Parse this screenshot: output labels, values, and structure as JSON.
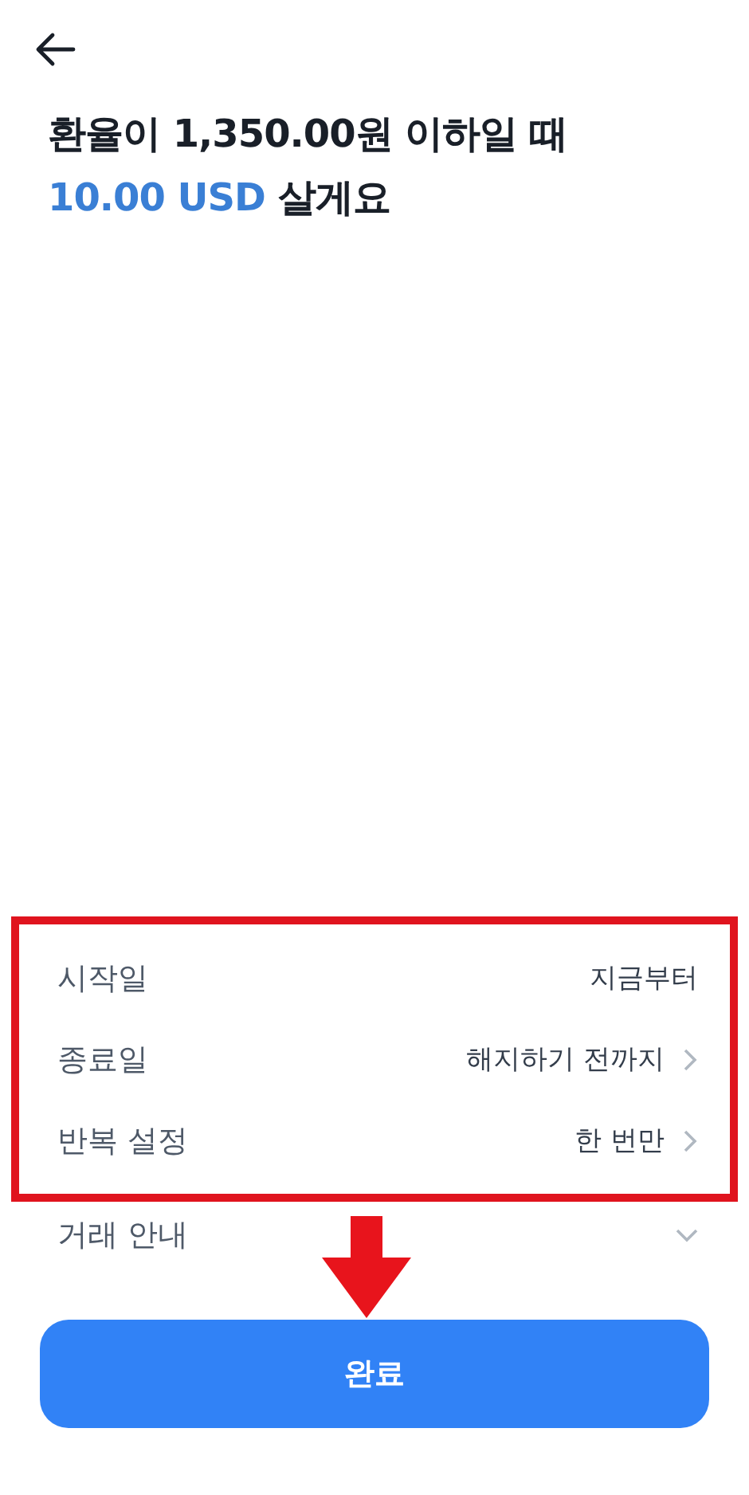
{
  "title": {
    "line_1": "환율이 1,350.00원 이하일 때",
    "amount": "10.00 USD",
    "line_2_rest": "살게요"
  },
  "settings": {
    "highlighted": true,
    "rows": [
      {
        "label": "시작일",
        "value": "지금부터",
        "has_chevron": false
      },
      {
        "label": "종료일",
        "value": "해지하기 전까지",
        "has_chevron": true
      },
      {
        "label": "반복 설정",
        "value": "한 번만",
        "has_chevron": true
      }
    ]
  },
  "info": {
    "label": "거래 안내",
    "expanded": false
  },
  "pointer_arrow": true,
  "button": {
    "label": "완료"
  }
}
